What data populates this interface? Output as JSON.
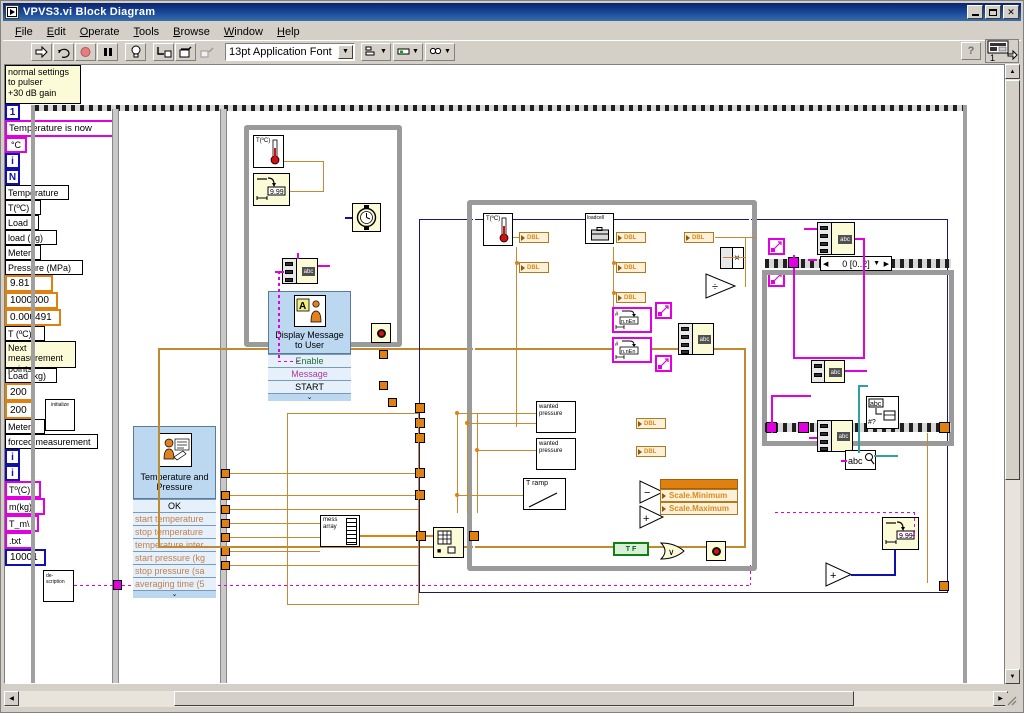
{
  "window": {
    "title": "VPVS3.vi Block Diagram",
    "icon": "labview-vi-icon",
    "buttons": {
      "minimize": "_",
      "maximize": "□",
      "close": "✕"
    }
  },
  "menubar": {
    "items": [
      {
        "label": "File",
        "mnemonic": "F"
      },
      {
        "label": "Edit",
        "mnemonic": "E"
      },
      {
        "label": "Operate",
        "mnemonic": "O"
      },
      {
        "label": "Tools",
        "mnemonic": "T"
      },
      {
        "label": "Browse",
        "mnemonic": "B"
      },
      {
        "label": "Window",
        "mnemonic": "W"
      },
      {
        "label": "Help",
        "mnemonic": "H"
      }
    ]
  },
  "toolbar": {
    "run_label": "run-arrow-icon",
    "run_continuous_label": "run-continuously-icon",
    "abort_label": "abort-execution-icon",
    "pause_label": "pause-icon",
    "highlight_label": "highlight-execution-bulb-icon",
    "step_into_label": "step-into-icon",
    "step_over_label": "step-over-icon",
    "step_out_label": "step-out-icon",
    "font_selector_value": "13pt Application Font",
    "align_label": "align-objects-icon",
    "distribute_label": "distribute-objects-icon",
    "reorder_label": "reorder-icon",
    "help_label": "?"
  },
  "diagram": {
    "comments": {
      "pulser_settings": "normal settings\nto pulser\n+30 dB gain",
      "next_measurement": "Next measurement\npoints"
    },
    "labels": {
      "temperature_is_now": "Temperature is now",
      "degc_const": "°C",
      "temperature": "Temperature",
      "t_degc": "T(ºC)",
      "t_degc_paren": "T (ºC)",
      "load": "Load",
      "load_kg": "load (kg)",
      "load_kg_cap": "Load (kg)",
      "meter": "Meter",
      "pressure_mpa": "Pressure (MPa)",
      "loadcell": "loadcell",
      "scale_minimum": "Scale.Minimum",
      "scale_maximum": "Scale.Maximum",
      "forced_measurement": "forced measurement",
      "wanted_pressure_1": "wanted\npressure",
      "wanted_pressure_2": "wanted\npressure",
      "t_ramp": "T ramp",
      "mess_array": "mess\narray",
      "initialize": "initialize",
      "description": "de-\nscription",
      "t_deg_c_pink": "Tº(C)",
      "m_kg_pink": "m(kg)",
      "t_m_pink": "T_m\\",
      "txt_ext": ".txt",
      "abc_concat": "abc",
      "abc_search": "abc",
      "tf_bool": "T F",
      "n_terminal": "N",
      "i_terminal": "i",
      "one_const": "1",
      "info_i": "i"
    },
    "constants": {
      "gravity": "9.81",
      "million": "1000000",
      "area": "0.000491",
      "delta_minus": "200",
      "delta_plus": "200",
      "offset": "10001",
      "iteration_start": "1"
    },
    "case_selector": {
      "value": "0 [0..2]",
      "left_arrow": "◀",
      "right_arrow": "▶",
      "drop": "▼"
    },
    "express_vis": [
      {
        "name": "display-message-to-user",
        "title": "Display Message\nto User",
        "rows": [
          "Enable",
          "Message",
          "START"
        ]
      },
      {
        "name": "temperature-and-pressure",
        "title": "Temperature and\nPressure",
        "rows": [
          "OK",
          "start temperature",
          "stop temperature",
          "temperature inter",
          "start pressure (kg",
          "stop pressure (sa",
          "averaging time (5"
        ]
      }
    ],
    "operators": {
      "multiply": "×",
      "divide": "÷",
      "subtract": "−",
      "add": "+",
      "add2": "+",
      "or": "∨"
    },
    "colors": {
      "numeric_wire": "#e08010",
      "string_wire": "#e000e0",
      "boolean_wire": "#108010",
      "path_wire": "#20a0a0",
      "integer_wire": "#1010b0",
      "comment_bg": "#fbfbd8",
      "express_vi_bg": "#bcd8f0"
    }
  },
  "scrollbars": {
    "vertical": {
      "up": "▲",
      "down": "▼"
    },
    "horizontal": {
      "left": "◀",
      "right": "▶"
    }
  }
}
